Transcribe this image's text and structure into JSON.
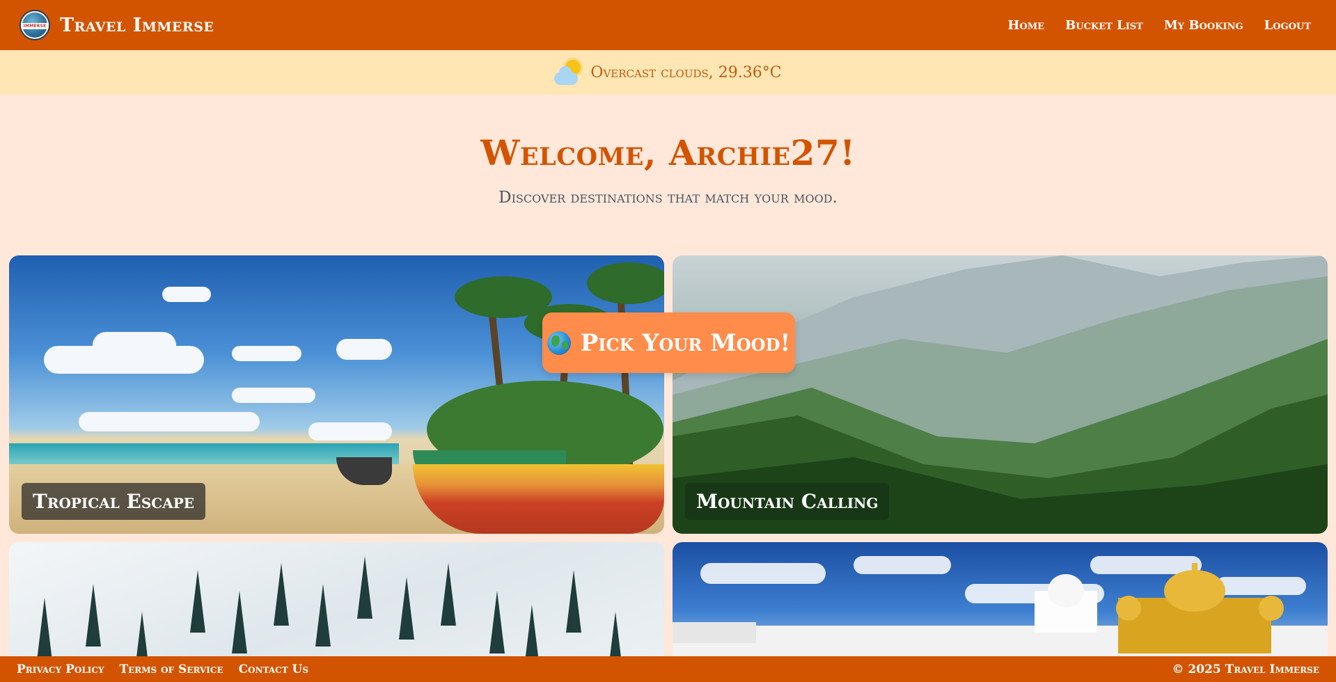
{
  "navbar": {
    "brand": "Travel Immerse",
    "logo_text": "IMMERSE",
    "links": [
      "Home",
      "Bucket List",
      "My Booking",
      "Logout"
    ]
  },
  "weather": {
    "icon": "sun-behind-cloud-icon",
    "text": "Overcast clouds, 29.36°C"
  },
  "hero": {
    "title": "Welcome, Archie27!",
    "subtitle": "Discover destinations that match your mood."
  },
  "cards": [
    {
      "label": "Tropical Escape"
    },
    {
      "label": "Mountain Calling"
    },
    {
      "label": ""
    },
    {
      "label": ""
    }
  ],
  "cta": {
    "icon": "globe-icon",
    "label": "Pick Your Mood!"
  },
  "footer": {
    "links": [
      "Privacy Policy",
      "Terms of Service",
      "Contact Us"
    ],
    "copyright": "© 2025 Travel Immerse"
  },
  "colors": {
    "primary": "#d35400",
    "background": "#ffe8da",
    "weather_bar": "#ffe6b3",
    "button": "#ff8c4a"
  }
}
